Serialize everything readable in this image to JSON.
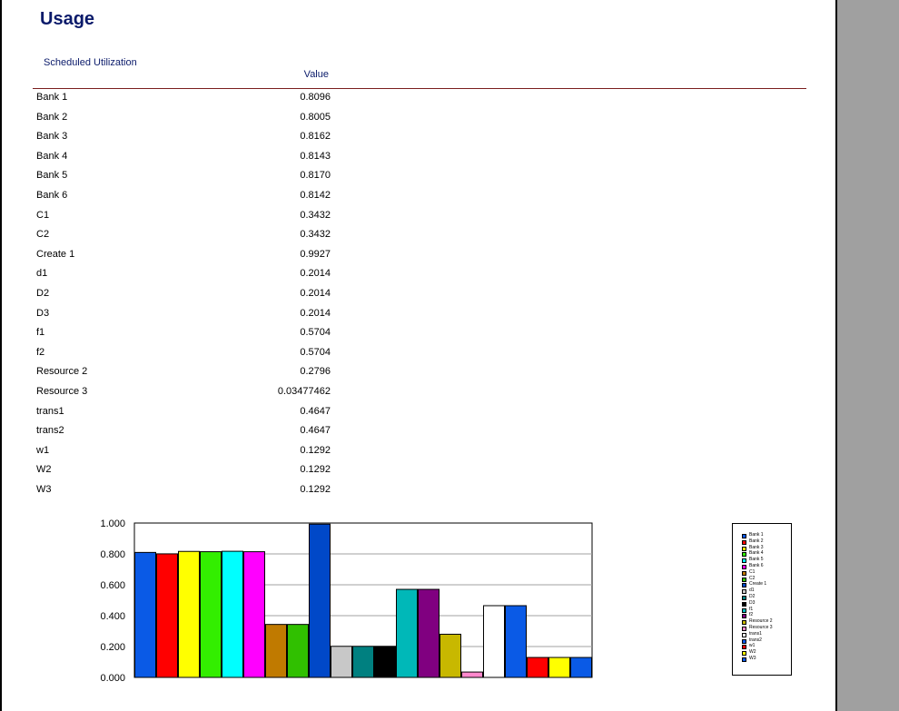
{
  "title": "Usage",
  "subtitle": "Scheduled Utilization",
  "column_header": "Value",
  "rows": [
    {
      "name": "Bank 1",
      "value": "0.8096"
    },
    {
      "name": "Bank 2",
      "value": "0.8005"
    },
    {
      "name": "Bank 3",
      "value": "0.8162"
    },
    {
      "name": "Bank 4",
      "value": "0.8143"
    },
    {
      "name": "Bank 5",
      "value": "0.8170"
    },
    {
      "name": "Bank 6",
      "value": "0.8142"
    },
    {
      "name": "C1",
      "value": "0.3432"
    },
    {
      "name": "C2",
      "value": "0.3432"
    },
    {
      "name": "Create 1",
      "value": "0.9927"
    },
    {
      "name": "d1",
      "value": "0.2014"
    },
    {
      "name": "D2",
      "value": "0.2014"
    },
    {
      "name": "D3",
      "value": "0.2014"
    },
    {
      "name": "f1",
      "value": "0.5704"
    },
    {
      "name": "f2",
      "value": "0.5704"
    },
    {
      "name": "Resource 2",
      "value": "0.2796"
    },
    {
      "name": "Resource 3",
      "value": "0.03477462"
    },
    {
      "name": "trans1",
      "value": "0.4647"
    },
    {
      "name": "trans2",
      "value": "0.4647"
    },
    {
      "name": "w1",
      "value": "0.1292"
    },
    {
      "name": "W2",
      "value": "0.1292"
    },
    {
      "name": "W3",
      "value": "0.1292"
    }
  ],
  "chart_data": {
    "type": "bar",
    "categories": [
      "Bank 1",
      "Bank 2",
      "Bank 3",
      "Bank 4",
      "Bank 5",
      "Bank 6",
      "C1",
      "C2",
      "Create 1",
      "d1",
      "D2",
      "D3",
      "f1",
      "f2",
      "Resource 2",
      "Resource 3",
      "trans1",
      "trans2",
      "w1",
      "W2",
      "W3"
    ],
    "values": [
      0.8096,
      0.8005,
      0.8162,
      0.8143,
      0.817,
      0.8142,
      0.3432,
      0.3432,
      0.9927,
      0.2014,
      0.2014,
      0.2014,
      0.5704,
      0.5704,
      0.2796,
      0.03477462,
      0.4647,
      0.4647,
      0.1292,
      0.1292,
      0.1292
    ],
    "colors": [
      "#0a5ae6",
      "#ff0000",
      "#ffff00",
      "#33ee00",
      "#00ffff",
      "#ff00ff",
      "#c07a00",
      "#30c000",
      "#0048c8",
      "#c8c8c8",
      "#008080",
      "#000000",
      "#00b8b8",
      "#800080",
      "#c8b800",
      "#ff88cc",
      "#ffffff",
      "#0a5ae6",
      "#ff0000",
      "#ffff00",
      "#0a5ae6"
    ],
    "yticks": [
      "0.000",
      "0.200",
      "0.400",
      "0.600",
      "0.800",
      "1.000"
    ],
    "ylim": [
      0,
      1
    ],
    "grid": true,
    "legend": "right"
  }
}
